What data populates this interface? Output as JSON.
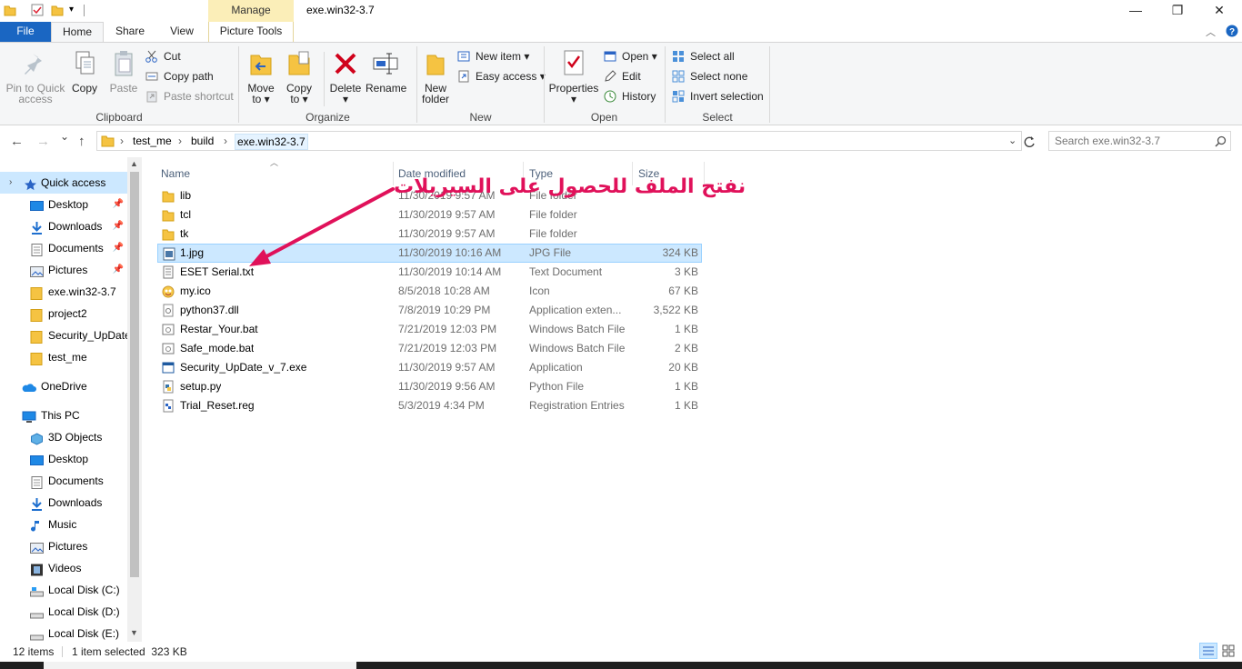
{
  "window": {
    "title": "exe.win32-3.7",
    "manage_label": "Manage",
    "minimize": "—",
    "maximize": "❐",
    "close": "✕"
  },
  "tabs": {
    "file": "File",
    "home": "Home",
    "share": "Share",
    "view": "View",
    "picture_tools": "Picture Tools"
  },
  "ribbon": {
    "clipboard": {
      "label": "Clipboard",
      "pin_line1": "Pin to Quick",
      "pin_line2": "access",
      "copy": "Copy",
      "paste": "Paste",
      "cut": "Cut",
      "copy_path": "Copy path",
      "paste_shortcut": "Paste shortcut"
    },
    "organize": {
      "label": "Organize",
      "move_line1": "Move",
      "move_line2": "to ▾",
      "copy_line1": "Copy",
      "copy_line2": "to ▾",
      "delete_line1": "Delete",
      "delete_line2": "▾",
      "rename": "Rename"
    },
    "new": {
      "label": "New",
      "new_folder_line1": "New",
      "new_folder_line2": "folder",
      "new_item": "New item ▾",
      "easy_access": "Easy access ▾"
    },
    "open": {
      "label": "Open",
      "properties_line1": "Properties",
      "properties_line2": "▾",
      "open": "Open ▾",
      "edit": "Edit",
      "history": "History"
    },
    "select": {
      "label": "Select",
      "select_all": "Select all",
      "select_none": "Select none",
      "invert": "Invert selection"
    }
  },
  "address": {
    "back": "←",
    "forward": "→",
    "recent": "⌄",
    "up": "↑",
    "crumbs": [
      "test_me",
      "build",
      "exe.win32-3.7"
    ],
    "separator": "›",
    "search_placeholder": "Search exe.win32-3.7"
  },
  "navpane": {
    "quick_access": "Quick access",
    "items": [
      {
        "label": "Desktop",
        "pinned": "📌"
      },
      {
        "label": "Downloads",
        "pinned": "📌"
      },
      {
        "label": "Documents",
        "pinned": "📌"
      },
      {
        "label": "Pictures",
        "pinned": "📌"
      },
      {
        "label": "exe.win32-3.7"
      },
      {
        "label": "project2"
      },
      {
        "label": "Security_UpDate"
      },
      {
        "label": "test_me"
      }
    ],
    "onedrive": "OneDrive",
    "this_pc": "This PC",
    "pc_items": [
      "3D Objects",
      "Desktop",
      "Documents",
      "Downloads",
      "Music",
      "Pictures",
      "Videos",
      "Local Disk (C:)",
      "Local Disk (D:)",
      "Local Disk (E:)"
    ]
  },
  "columns": {
    "name": "Name",
    "date": "Date modified",
    "type": "Type",
    "size": "Size"
  },
  "files": [
    {
      "name": "lib",
      "date": "11/30/2019 9:57 AM",
      "type": "File folder",
      "size": "",
      "icon": "folder-icon"
    },
    {
      "name": "tcl",
      "date": "11/30/2019 9:57 AM",
      "type": "File folder",
      "size": "",
      "icon": "folder-icon"
    },
    {
      "name": "tk",
      "date": "11/30/2019 9:57 AM",
      "type": "File folder",
      "size": "",
      "icon": "folder-icon"
    },
    {
      "name": "1.jpg",
      "date": "11/30/2019 10:16 AM",
      "type": "JPG File",
      "size": "324 KB",
      "icon": "image-file-icon"
    },
    {
      "name": "ESET Serial.txt",
      "date": "11/30/2019 10:14 AM",
      "type": "Text Document",
      "size": "3 KB",
      "icon": "text-file-icon"
    },
    {
      "name": "my.ico",
      "date": "8/5/2018 10:28 AM",
      "type": "Icon",
      "size": "67 KB",
      "icon": "ico-file-icon"
    },
    {
      "name": "python37.dll",
      "date": "7/8/2019 10:29 PM",
      "type": "Application exten...",
      "size": "3,522 KB",
      "icon": "dll-file-icon"
    },
    {
      "name": "Restar_Your.bat",
      "date": "7/21/2019 12:03 PM",
      "type": "Windows Batch File",
      "size": "1 KB",
      "icon": "batch-file-icon"
    },
    {
      "name": "Safe_mode.bat",
      "date": "7/21/2019 12:03 PM",
      "type": "Windows Batch File",
      "size": "2 KB",
      "icon": "batch-file-icon"
    },
    {
      "name": "Security_UpDate_v_7.exe",
      "date": "11/30/2019 9:57 AM",
      "type": "Application",
      "size": "20 KB",
      "icon": "exe-file-icon"
    },
    {
      "name": "setup.py",
      "date": "11/30/2019 9:56 AM",
      "type": "Python File",
      "size": "1 KB",
      "icon": "python-file-icon"
    },
    {
      "name": "Trial_Reset.reg",
      "date": "5/3/2019 4:34 PM",
      "type": "Registration Entries",
      "size": "1 KB",
      "icon": "reg-file-icon"
    }
  ],
  "annotation": "نفتح الملف للحصول على السيريلات",
  "status": {
    "items": "12 items",
    "selected": "1 item selected  323 KB"
  },
  "colors": {
    "accent": "#1a66c2",
    "selection": "#cce8ff",
    "annotation": "#e0115a",
    "manage": "#fbeeb8"
  }
}
